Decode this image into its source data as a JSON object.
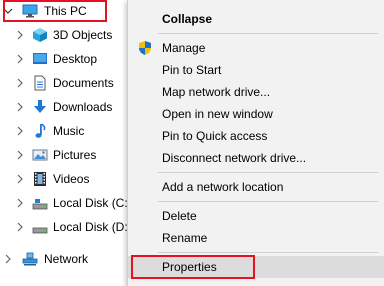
{
  "nav_tree": {
    "items": [
      {
        "label": "This PC",
        "icon": "computer-icon",
        "expanded": true
      },
      {
        "label": "3D Objects",
        "icon": "cube-icon"
      },
      {
        "label": "Desktop",
        "icon": "desktop-icon"
      },
      {
        "label": "Documents",
        "icon": "document-icon"
      },
      {
        "label": "Downloads",
        "icon": "download-icon"
      },
      {
        "label": "Music",
        "icon": "music-icon"
      },
      {
        "label": "Pictures",
        "icon": "pictures-icon"
      },
      {
        "label": "Videos",
        "icon": "videos-icon"
      },
      {
        "label": "Local Disk (C:)",
        "icon": "drive-icon"
      },
      {
        "label": "Local Disk (D:)",
        "icon": "drive-icon"
      },
      {
        "label": "Network",
        "icon": "network-icon"
      }
    ]
  },
  "context_menu": {
    "items": [
      {
        "label": "Collapse",
        "bold": true
      },
      {
        "label": "Manage",
        "icon": "shield-icon"
      },
      {
        "label": "Pin to Start"
      },
      {
        "label": "Map network drive..."
      },
      {
        "label": "Open in new window"
      },
      {
        "label": "Pin to Quick access"
      },
      {
        "label": "Disconnect network drive..."
      },
      {
        "label": "Add a network location"
      },
      {
        "label": "Delete"
      },
      {
        "label": "Rename"
      },
      {
        "label": "Properties",
        "hovered": true
      }
    ]
  },
  "colors": {
    "highlight": "#e81123",
    "menu_background": "#f2f2f2",
    "hover_background": "#dcdcdc",
    "separator": "#d0d0d0",
    "folder_blue": "#2b78d4"
  }
}
